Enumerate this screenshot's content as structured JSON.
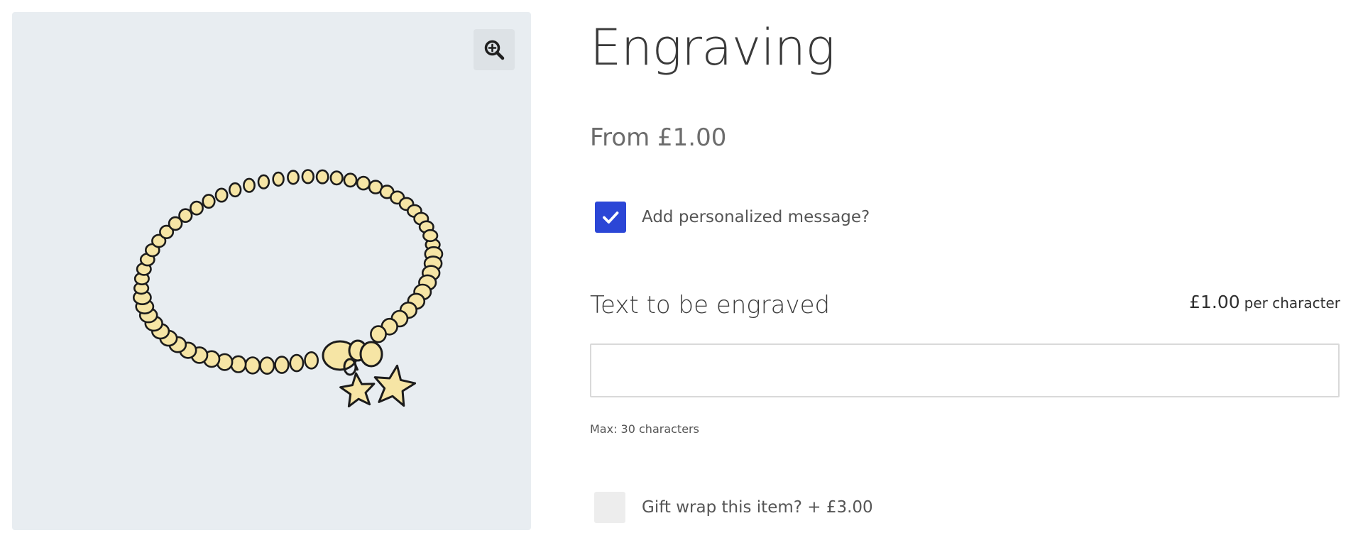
{
  "product": {
    "title": "Engraving",
    "price": "From £1.00"
  },
  "gallery": {
    "zoom_icon": "zoom-in-icon",
    "colors": {
      "background": "#e8edf1",
      "bead_fill": "#f6e5a5",
      "outline": "#1c1c1c"
    }
  },
  "options": {
    "personalized": {
      "label": "Add personalized message?",
      "checked": true
    },
    "engraving": {
      "label": "Text to be engraved",
      "price_amount": "£1.00",
      "price_unit": "per character",
      "value": "",
      "placeholder": "",
      "max_note": "Max: 30 characters"
    },
    "gift_wrap": {
      "label": "Gift wrap this item? + £3.00",
      "checked": false
    }
  },
  "colors": {
    "accent": "#2b46d6",
    "unchecked": "#ededed"
  }
}
